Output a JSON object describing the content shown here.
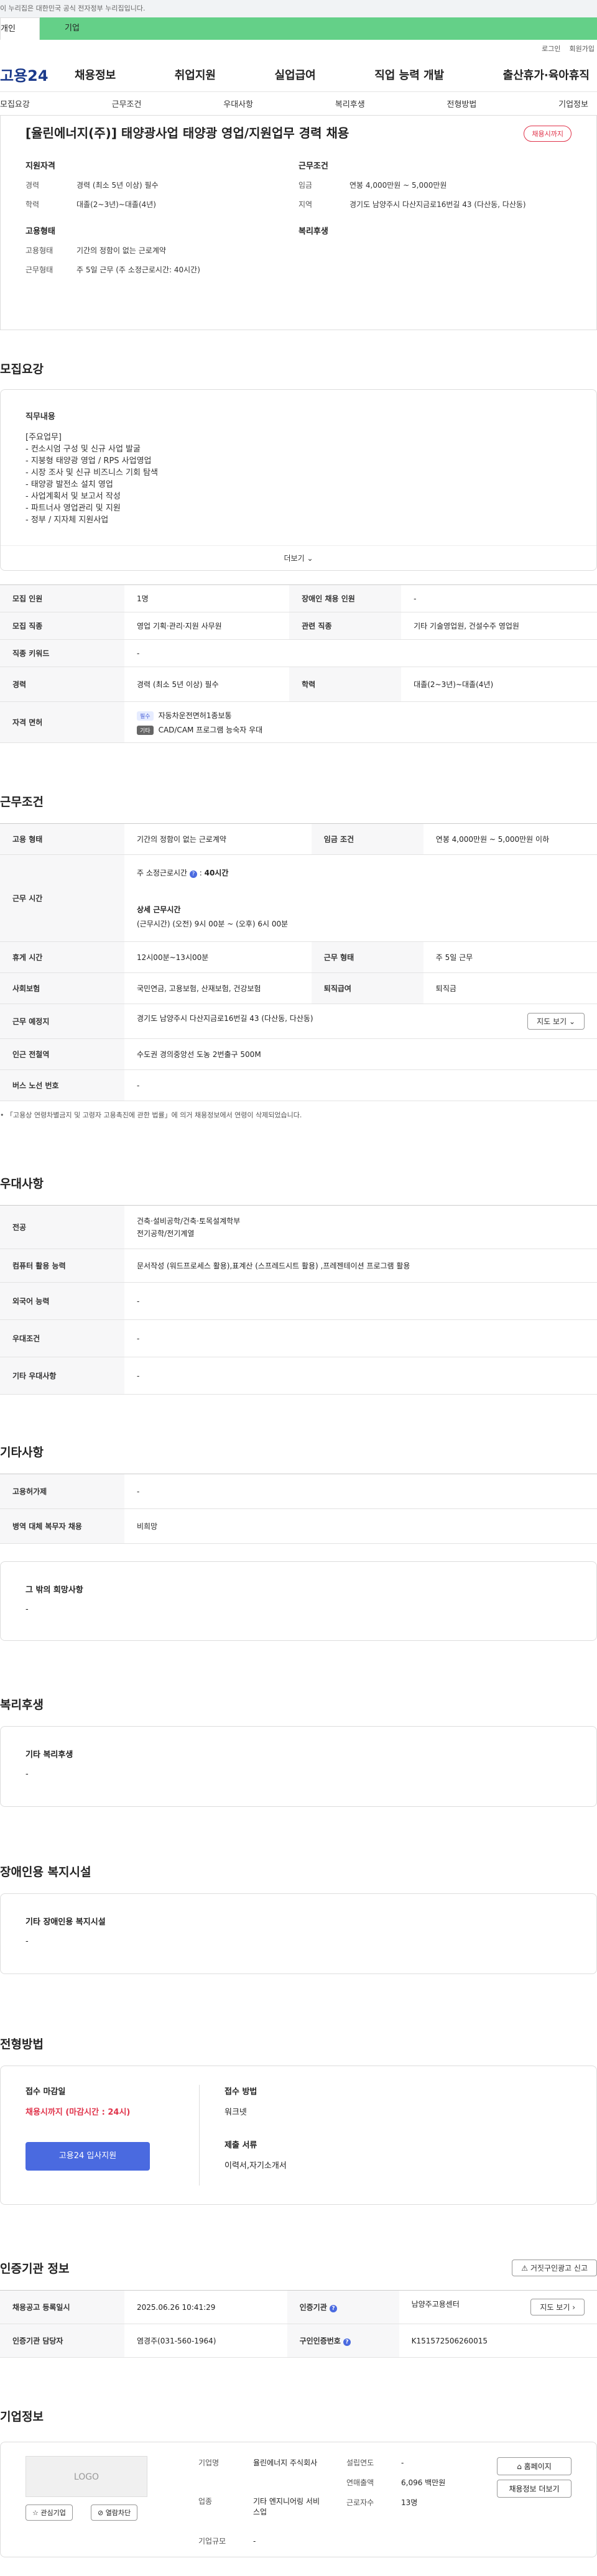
{
  "topbar": {
    "notice": "이 누리집은 대한민국 공식 전자정부 누리집입니다."
  },
  "usertabs": {
    "personal": "개인",
    "business": "기업"
  },
  "util": {
    "login": "로그인",
    "join": "회원가입"
  },
  "gnb": {
    "logo": "고용24",
    "menu": [
      "채용정보",
      "취업지원",
      "실업급여",
      "직업 능력 개발",
      "출산휴가·육아휴직"
    ]
  },
  "tabs": [
    "모집요강",
    "근무조건",
    "우대사항",
    "복리후생",
    "전형방법",
    "기업정보"
  ],
  "summary": {
    "title": "[율린에너지(주)] 태양광사업 태양광 영업/지원업무 경력 채용",
    "badge": "채용시까지",
    "qual": {
      "title": "지원자격",
      "items": [
        {
          "k": "경력",
          "v": "경력 (최소 5년 이상) 필수"
        },
        {
          "k": "학력",
          "v": "대졸(2~3년)~대졸(4년)"
        }
      ]
    },
    "cond": {
      "title": "근무조건",
      "items": [
        {
          "k": "임금",
          "v": "연봉 4,000만원 ~ 5,000만원"
        },
        {
          "k": "지역",
          "v": "경기도 남양주시 다산지금로16번길 43 (다산동, 다산동)"
        }
      ]
    },
    "emp": {
      "title": "고용형태",
      "items": [
        {
          "k": "고용형태",
          "v": "기간의 정함이 없는 근로계약"
        },
        {
          "k": "근무형태",
          "v": "주 5일 근무 (주 소정근로시간: 40시간)"
        }
      ]
    },
    "welfare": {
      "title": "복리후생"
    }
  },
  "recruit": {
    "title": "모집요강",
    "duty_label": "직무내용",
    "duty_lines": [
      "[주요업무]",
      "- 컨소시엄 구성 및 신규 사업 발굴",
      "- 지붕형 태양광 영업 / RPS 사업영업",
      "- 시장 조사 및 신규 비즈니스 기회 탐색",
      "- 태양광 발전소 설치 영업",
      "- 사업계획서 및 보고서 작성",
      "- 파트너사 영업관리 및 지원",
      "- 정부 / 지자체 지원사업"
    ],
    "more": "더보기",
    "rows": [
      {
        "k1": "모집 인원",
        "v1": "1명",
        "k2": "장애인 채용 인원",
        "v2": "-"
      },
      {
        "k1": "모집 직종",
        "v1": "영업 기획·관리·지원 사무원",
        "k2": "관련 직종",
        "v2": "기타 기술영업원, 건설수주 영업원"
      },
      {
        "k1": "직종 키워드",
        "v1": "-"
      },
      {
        "k1": "경력",
        "v1": "경력 (최소 5년 이상) 필수",
        "k2": "학력",
        "v2": "대졸(2~3년)~대졸(4년)"
      }
    ],
    "license_label": "자격 면허",
    "licenses": [
      {
        "tag": "필수",
        "name": "자동차운전면허1종보통"
      },
      {
        "tag": "기타",
        "name": "CAD/CAM 프로그램 능숙자 우대"
      }
    ]
  },
  "work": {
    "title": "근무조건",
    "emp_type_k": "고용 형태",
    "emp_type_v": "기간의 정함이 없는 근로계약",
    "wage_k": "임금 조건",
    "wage_v": "연봉 4,000만원 ~ 5,000만원 이하",
    "hours_k": "근무 시간",
    "hours_a": "주 소정근로시간",
    "hours_a_v": "40시간",
    "hours_b": "상세 근무시간",
    "hours_b_v": "(근무시간) (오전) 9시 00분 ~ (오후) 6시 00분",
    "break_k": "휴게 시간",
    "break_v": "12시00분~13시00분",
    "form_k": "근무 형태",
    "form_v": "주 5일 근무",
    "ins_k": "사회보험",
    "ins_v": "국민연금, 고용보험, 산재보험, 건강보험",
    "ret_k": "퇴직급여",
    "ret_v": "퇴직금",
    "place_k": "근무 예정지",
    "place_v": "경기도 남양주시 다산지금로16번길 43 (다산동, 다산동)",
    "map_btn": "지도 보기",
    "subway_k": "인근 전철역",
    "subway_v": "수도권 경의중앙선 도농 2번출구 500M",
    "bus_k": "버스 노선 번호",
    "bus_v": "-",
    "note": "「고용상 연령차별금지 및 고령자 고용촉진에 관한 법률」에 의거 채용정보에서 연령이 삭제되었습니다."
  },
  "pref": {
    "title": "우대사항",
    "rows": [
      {
        "k": "전공",
        "v": "건축·설비공학/건축·토목설계학부\n전기공학/전기계열"
      },
      {
        "k": "컴퓨터 활용 능력",
        "v": "문서작성 (워드프로세스 활용),표계산 (스프레드시트 활용) ,프레젠테이션 프로그램 활용"
      },
      {
        "k": "외국어 능력",
        "v": "-"
      },
      {
        "k": "우대조건",
        "v": "-"
      },
      {
        "k": "기타 우대사항",
        "v": "-"
      }
    ]
  },
  "etc": {
    "title": "기타사항",
    "rows": [
      {
        "k": "고용허가제",
        "v": "-"
      },
      {
        "k": "병역 대체 복무자 채용",
        "v": "비희망"
      }
    ],
    "hope_label": "그 밖의 희망사항",
    "hope_v": "-"
  },
  "welfare": {
    "title": "복리후생",
    "label": "기타 복리후생",
    "v": "-"
  },
  "disabled": {
    "title": "장애인용 복지시설",
    "label": "기타 장애인용 복지시설",
    "v": "-"
  },
  "apply": {
    "title": "전형방법",
    "deadline_label": "접수 마감일",
    "deadline_v": "채용시까지 (마감시간 : 24시)",
    "btn": "고용24 입사지원",
    "method_label": "접수 방법",
    "method_v": "워크넷",
    "docs_label": "제출 서류",
    "docs_v": "이력서,자기소개서"
  },
  "agency": {
    "title": "인증기관 정보",
    "report_btn": "거짓구인광고 신고",
    "reg_k": "채용공고 등록일시",
    "reg_v": "2025.06.26 10:41:29",
    "org_k": "인증기관",
    "org_v": "남양주고용센터",
    "map_btn": "지도 보기",
    "mgr_k": "인증기관 담당자",
    "mgr_v": "염경주(031-560-1964)",
    "no_k": "구인인증번호",
    "no_v": "K151572506260015"
  },
  "company": {
    "title": "기업정보",
    "logo": "LOGO",
    "fav_btn": "관심기업",
    "block_btn": "열람차단",
    "name_k": "기업명",
    "name_v": "율린에너지 주식회사",
    "ind_k": "업종",
    "ind_v": "기타 엔지니어링 서비스업",
    "size_k": "기업규모",
    "size_v": "-",
    "est_k": "설립연도",
    "est_v": "-",
    "sales_k": "연매출액",
    "sales_v": "6,096 백만원",
    "emp_k": "근로자수",
    "emp_v": "13명",
    "home_btn": "홈페이지",
    "list_btn": "채용정보 더보기"
  }
}
